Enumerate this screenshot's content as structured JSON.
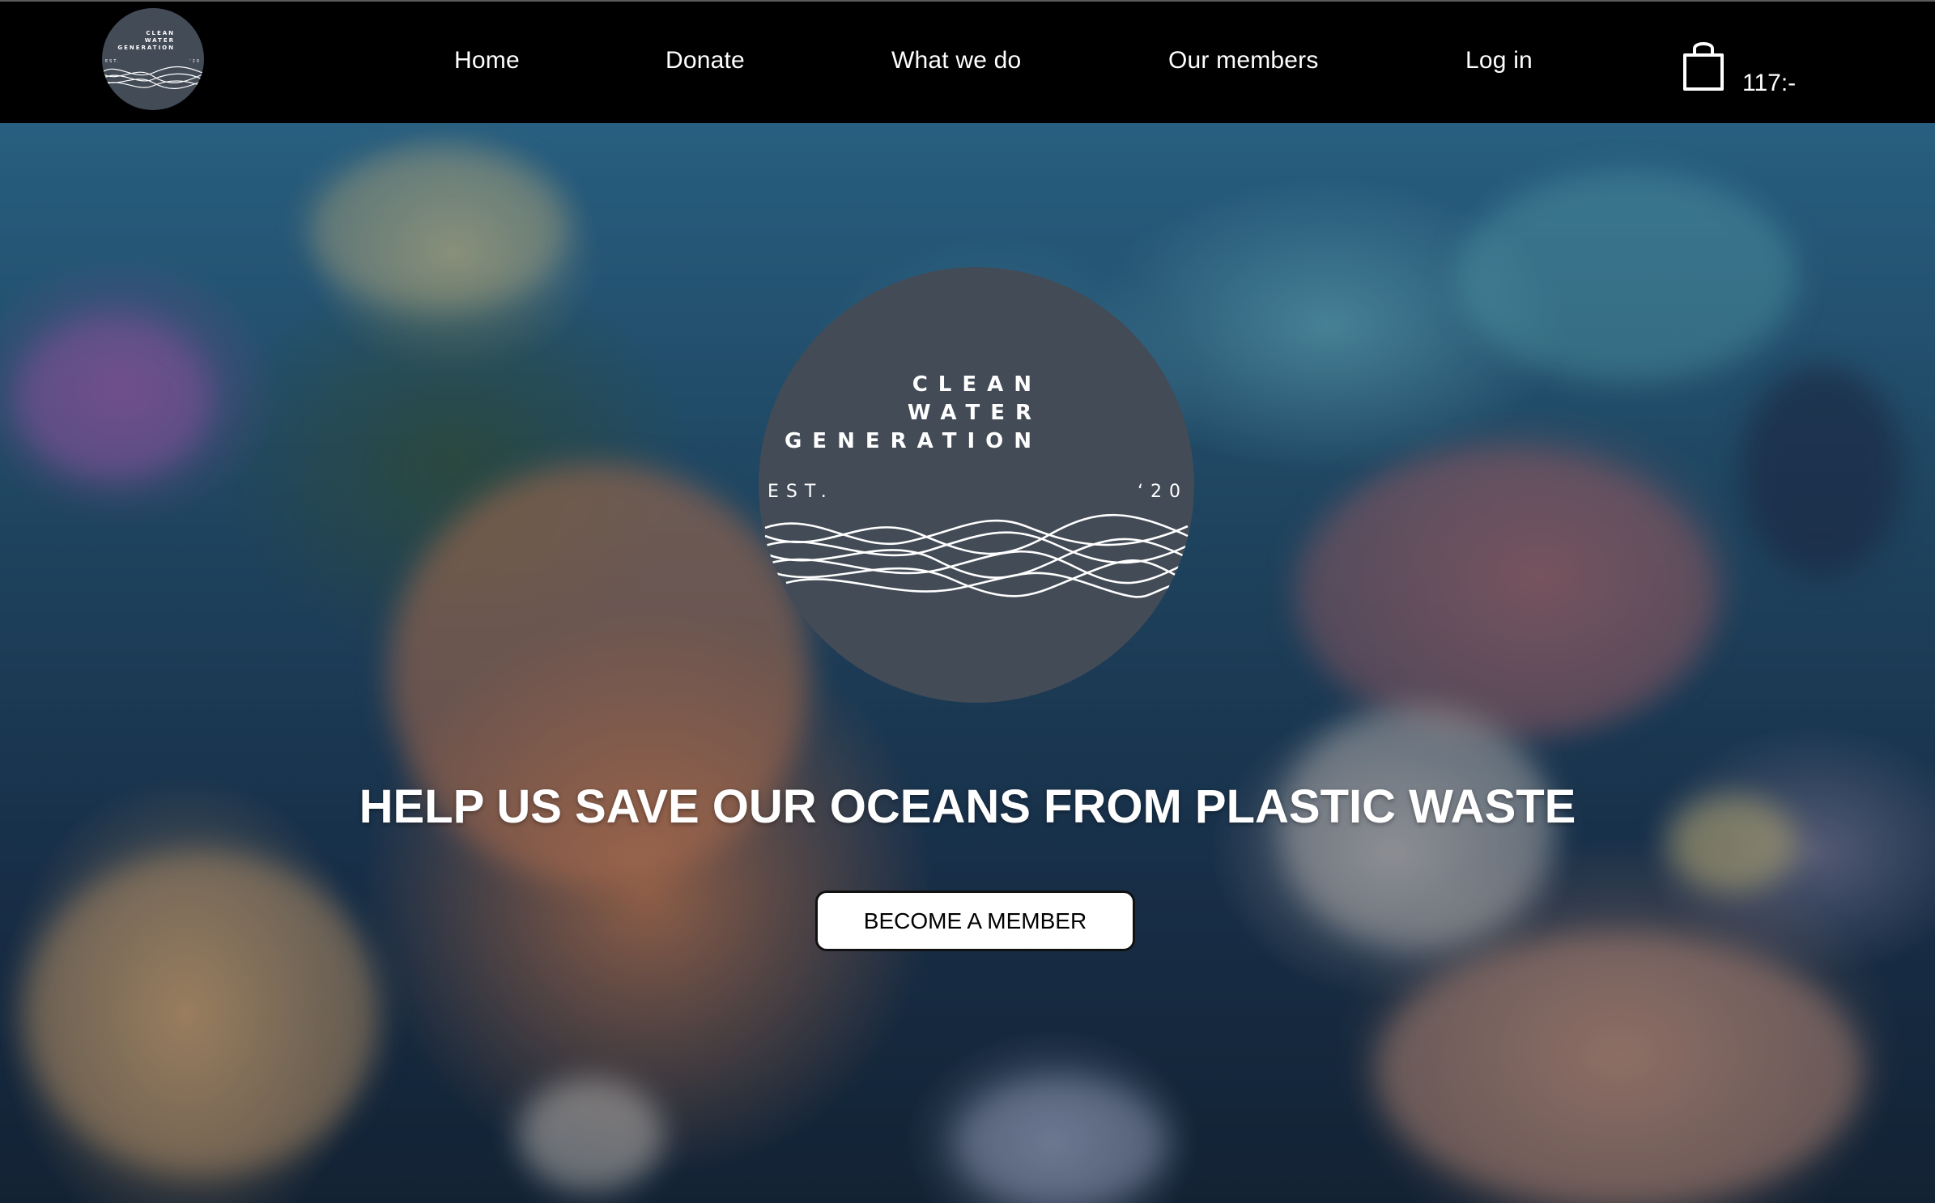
{
  "header": {
    "logo": {
      "line1": "CLEAN",
      "line2": "WATER",
      "line3": "GENERATION",
      "est_left": "EST.",
      "est_right": "'20",
      "color": "#434b57"
    },
    "nav": {
      "home": "Home",
      "donate": "Donate",
      "what_we_do": "What we do",
      "our_members": "Our members",
      "log_in": "Log in"
    },
    "cart": {
      "icon": "shopping-bag-icon",
      "total": "117:-"
    },
    "background": "#000000"
  },
  "hero": {
    "logo": {
      "line1": "CLEAN",
      "line2": "WATER",
      "line3": "GENERATION",
      "est_left": "EST.",
      "est_right": "‘20"
    },
    "title": "HELP US SAVE OUR OCEANS FROM PLASTIC WASTE",
    "cta_label": "BECOME A MEMBER",
    "background_description_color": "#24506f"
  }
}
